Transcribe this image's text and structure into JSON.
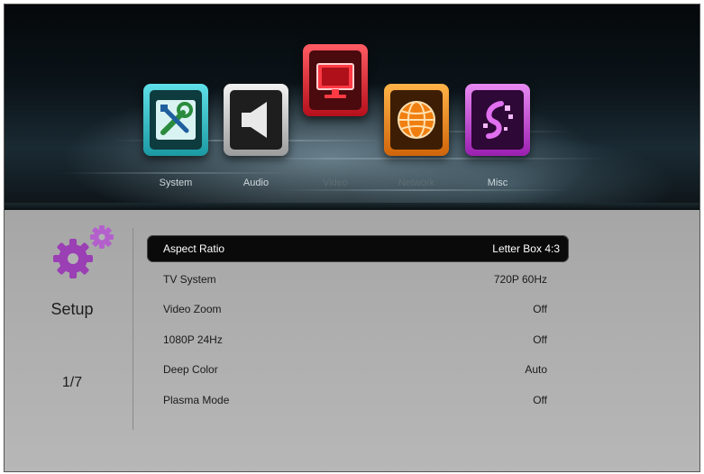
{
  "menu": {
    "items": [
      {
        "label": "System",
        "icon": "wrench-screwdriver-icon",
        "color": "#33c6cf"
      },
      {
        "label": "Audio",
        "icon": "speaker-icon",
        "color": "#d7d7d7"
      },
      {
        "label": "Video",
        "icon": "monitor-icon",
        "color": "#e0202c",
        "selected": true
      },
      {
        "label": "Network",
        "icon": "globe-icon",
        "color": "#f08a16"
      },
      {
        "label": "Misc",
        "icon": "misc-icon",
        "color": "#c83ad8"
      }
    ]
  },
  "panel": {
    "title": "Setup",
    "page": "1/7",
    "icon": "gears-icon",
    "accent": "#9a3fb4"
  },
  "settings": [
    {
      "label": "Aspect Ratio",
      "value": "Letter Box 4:3",
      "selected": true
    },
    {
      "label": "TV System",
      "value": "720P 60Hz"
    },
    {
      "label": "Video Zoom",
      "value": "Off"
    },
    {
      "label": "1080P 24Hz",
      "value": "Off"
    },
    {
      "label": "Deep Color",
      "value": "Auto"
    },
    {
      "label": "Plasma Mode",
      "value": "Off"
    }
  ]
}
